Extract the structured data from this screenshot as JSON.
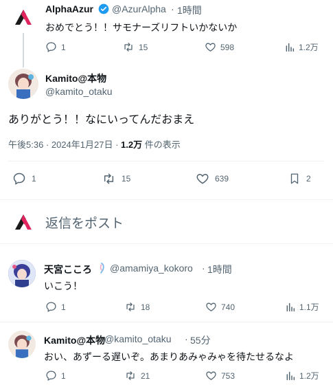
{
  "parent_tweet": {
    "name": "AlphaAzur",
    "handle": "@AzurAlpha",
    "time": "1時間",
    "text": "おめでとう！！サモナーズリフトいかないか",
    "replies": "1",
    "reposts": "15",
    "likes": "598",
    "views": "1.2万"
  },
  "main_tweet": {
    "name": "Kamito@本物",
    "handle": "@kamito_otaku",
    "text": "ありがとう！！なにいってんだおまえ",
    "timestamp": "午後5:36 · 2024年1月27日 · ",
    "views_count": "1.2万",
    "views_label": " 件の表示",
    "replies": "1",
    "reposts": "15",
    "likes": "639",
    "bookmarks": "2"
  },
  "reply_box": {
    "placeholder": "返信をポスト"
  },
  "replies": [
    {
      "name": "天宮こころ",
      "handle": "@amamiya_kokoro",
      "time": "1時間",
      "text": "いこう！",
      "replies": "1",
      "reposts": "18",
      "likes": "740",
      "views": "1.1万"
    },
    {
      "name": "Kamito@本物",
      "handle": "@kamito_otaku",
      "time": "55分",
      "text": "おい、あずーる遅いぞ。あまりあみゃみゃを待たせるなよ",
      "replies": "1",
      "reposts": "21",
      "likes": "753",
      "views": "1.2万"
    }
  ],
  "colors": {
    "accent": "#1d9bf0",
    "text": "#0f1419",
    "secondary": "#536471",
    "brand_red": "#e0245e"
  }
}
